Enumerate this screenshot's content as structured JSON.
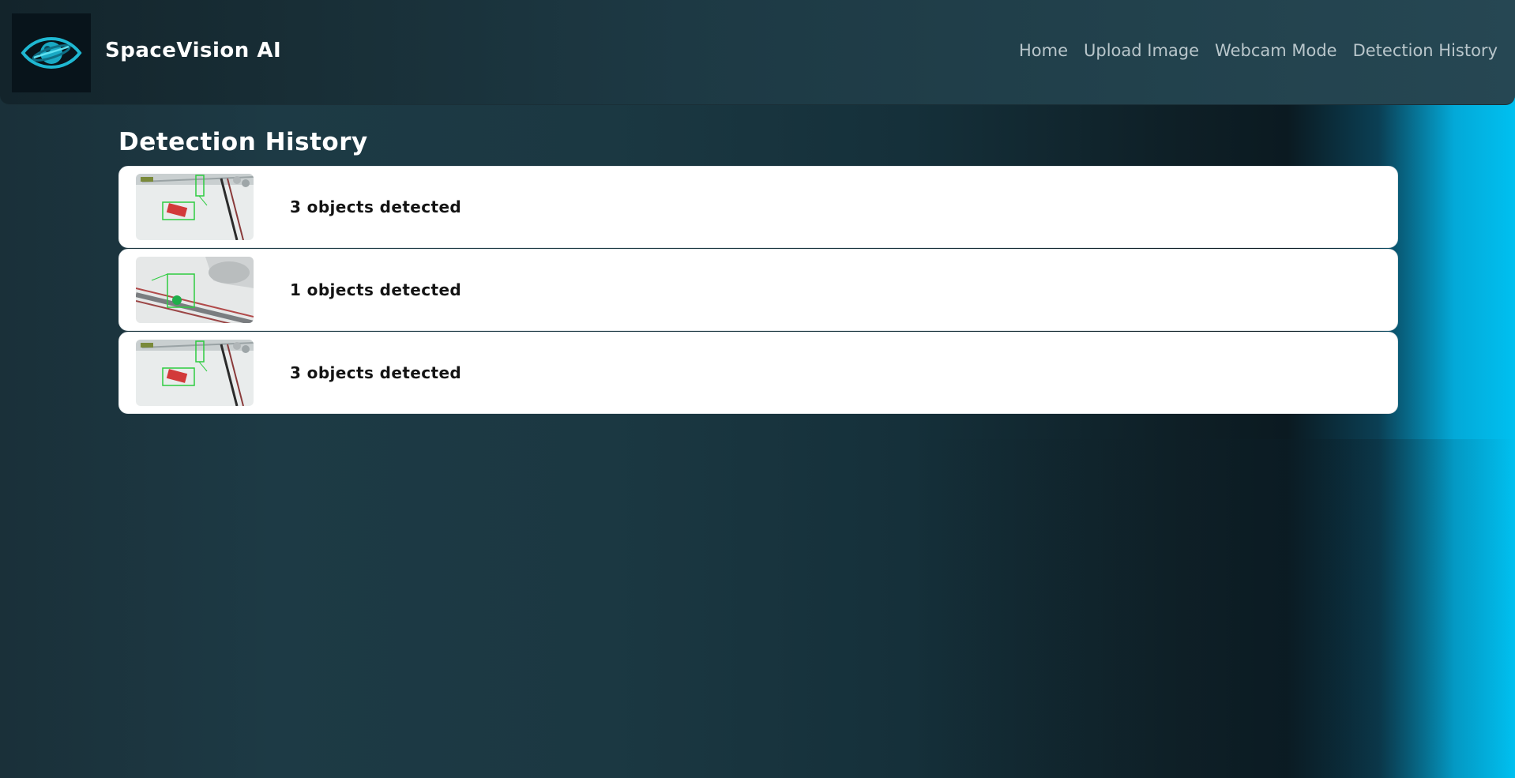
{
  "app": {
    "title": "SpaceVision AI",
    "logo_icon": "planet-eye-icon"
  },
  "nav": {
    "items": [
      {
        "label": "Home"
      },
      {
        "label": "Upload Image"
      },
      {
        "label": "Webcam Mode"
      },
      {
        "label": "Detection History"
      }
    ]
  },
  "page": {
    "heading": "Detection History"
  },
  "history": {
    "items": [
      {
        "text": "3 objects detected",
        "thumb": "detection-thumbnail"
      },
      {
        "text": "1 objects detected",
        "thumb": "detection-thumbnail"
      },
      {
        "text": "3 objects detected",
        "thumb": "detection-thumbnail"
      }
    ]
  },
  "colors": {
    "accent": "#00c0f0",
    "background": "#1b3842",
    "header": "#1d3944",
    "card": "#ffffff",
    "detection_box": "#2ecc40"
  }
}
